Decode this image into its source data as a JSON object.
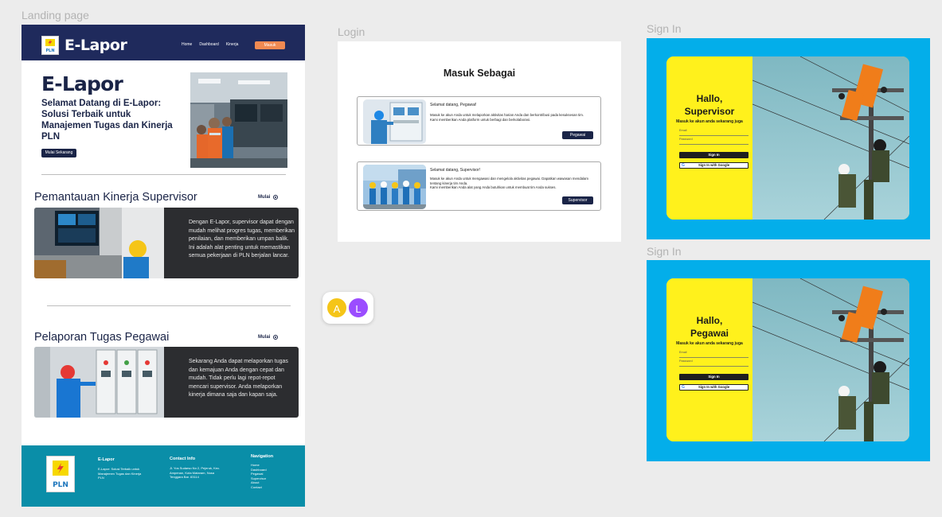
{
  "frames": {
    "landing_label": "Landing page",
    "login_label": "Login",
    "signin1_label": "Sign In",
    "signin2_label": "Sign In"
  },
  "landing": {
    "logo_text": "PLN",
    "brand": "E-Lapor",
    "nav": [
      "Home",
      "Dashboard",
      "Kinerja"
    ],
    "login_button": "Masuk",
    "hero_title": "E-Lapor",
    "hero_subtitle": "Selamat Datang di E-Lapor: Solusi Terbaik untuk Manajemen Tugas dan Kinerja PLN",
    "cta": "Mulai Sekarang",
    "section1": {
      "title": "Pemantauan Kinerja Supervisor",
      "mulai": "Mulai",
      "text": "Dengan E-Lapor, supervisor dapat dengan mudah melihat progres tugas, memberikan penilaian, dan memberikan umpan balik. Ini adalah alat penting untuk memastikan semua pekerjaan di PLN berjalan lancar."
    },
    "section2": {
      "title": "Pelaporan Tugas Pegawai",
      "mulai": "Mulai",
      "text": "Sekarang Anda dapat melaporkan tugas dan kemajuan Anda dengan cepat dan mudah. Tidak perlu lagi repot-repot mencari supervisor. Anda melaporkan kinerja dimana saja dan kapan saja."
    },
    "footer": {
      "logo_text": "PLN",
      "brand_title": "E-Lapor",
      "brand_text": "E-Lapor: Solusi Terbaik untuk Manajemen Tugas dan Kinerja PLN",
      "contact_title": "Contact Info",
      "contact_text": "Jl. Yos Sudarso No 2, Pejeruk, Kec. Ampenan, Kota Mataram, Nusa Tenggara Bar. 83114",
      "nav_title": "Navigation",
      "nav_items": [
        "Home",
        "Dashboard",
        "Pegawai",
        "Supervisor",
        "About",
        "Contact"
      ]
    }
  },
  "login": {
    "title": "Masuk Sebagai",
    "cards": [
      {
        "greeting": "Selamat datang, Pegawai!",
        "desc1": "Masuk ke akun Anda untuk melaporkan aktivitas harian Anda dan berkontribusi pada kesuksesan tim.",
        "desc2": "Kami memberikan Anda platform untuk berbagi dan berkolaborasi.",
        "button": "Pegawai"
      },
      {
        "greeting": "Selamat datang, Supervisor!",
        "desc1": "Masuk ke akun Anda untuk mengawasi dan mengelola aktivitas pegawai. Dapatkan wawasan mendalam tentang kinerja tim Anda.",
        "desc2": "Kami memberikan Anda alat yang Anda butuhkan untuk membuat tim Anda sukses.",
        "button": "Supervisor"
      }
    ]
  },
  "signin_supervisor": {
    "hello": "Hallo,",
    "role": "Supervisor",
    "sub": "Masuk ke akun anda sekarang juga",
    "email_placeholder": "Email",
    "password_placeholder": "Password",
    "signin_button": "Sign In",
    "google_button": "Sign In with Google"
  },
  "signin_pegawai": {
    "hello": "Hallo,",
    "role": "Pegawai",
    "sub": "Masuk ke akun anda sekarang juga",
    "email_placeholder": "Email",
    "password_placeholder": "Password",
    "signin_button": "Sign In",
    "google_button": "Sign In with Google"
  },
  "avatars": [
    "A",
    "L"
  ],
  "colors": {
    "navy": "#1f2a5c",
    "orange": "#f08a52",
    "teal_footer": "#0a8ea8",
    "signin_bg": "#03aeea",
    "signin_yellow": "#fff11c"
  }
}
